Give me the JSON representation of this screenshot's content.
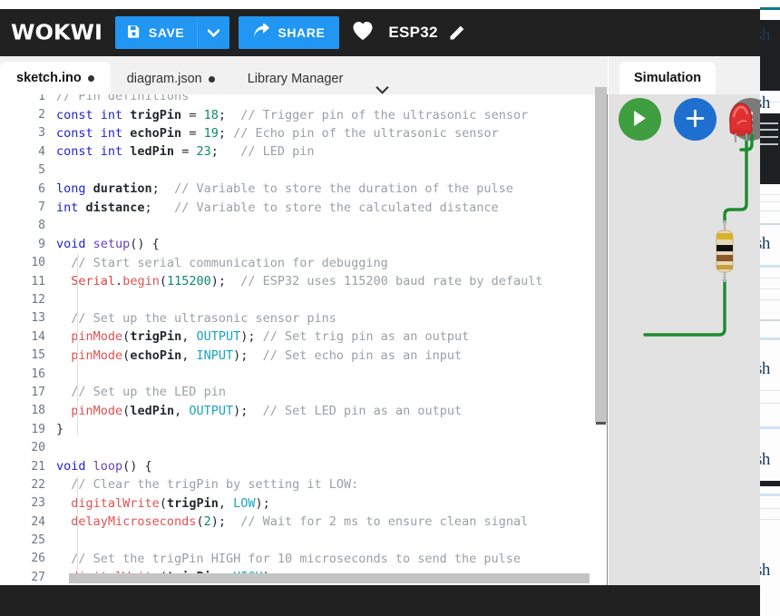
{
  "toolbar": {
    "logo": "WOKWI",
    "save_label": "SAVE",
    "save_icon": "floppy-disk-icon",
    "save_caret_icon": "chevron-down-icon",
    "share_label": "SHARE",
    "share_icon": "share-arrow-icon",
    "favorite_icon": "heart-icon",
    "project_name": "ESP32",
    "rename_icon": "pencil-icon"
  },
  "tabs": {
    "items": [
      {
        "label": "sketch.ino",
        "modified": true,
        "active": true
      },
      {
        "label": "diagram.json",
        "modified": true,
        "active": false
      },
      {
        "label": "Library Manager",
        "modified": false,
        "active": false
      }
    ],
    "overflow_icon": "chevron-down-icon"
  },
  "simulation": {
    "tab_label": "Simulation",
    "play_icon": "play-icon",
    "add_icon": "plus-icon",
    "menu_icon": "kebab-menu-icon",
    "components": [
      {
        "name": "led",
        "color": "#e03030",
        "label": "red LED"
      },
      {
        "name": "resistor",
        "label": "220 ohm resistor",
        "bands": [
          "#d8b22a",
          "#111111",
          "#8a5a28",
          "#c8a03a"
        ]
      },
      {
        "name": "wire-green",
        "color": "#1e8c2e"
      }
    ]
  },
  "editor": {
    "scroll_h_present": true,
    "scroll_v_present": true,
    "lines": [
      {
        "n": 1,
        "tokens": [
          {
            "t": "// Pin definitions",
            "c": "t-com"
          }
        ]
      },
      {
        "n": 2,
        "tokens": [
          {
            "t": "const int ",
            "c": "t-kw"
          },
          {
            "t": "trigPin",
            "c": "t-var"
          },
          {
            "t": " = ",
            "c": "t-plain"
          },
          {
            "t": "18",
            "c": "t-num"
          },
          {
            "t": ";  ",
            "c": "t-plain"
          },
          {
            "t": "// Trigger pin of the ultrasonic sensor",
            "c": "t-com"
          }
        ]
      },
      {
        "n": 3,
        "tokens": [
          {
            "t": "const int ",
            "c": "t-kw"
          },
          {
            "t": "echoPin",
            "c": "t-var"
          },
          {
            "t": " = ",
            "c": "t-plain"
          },
          {
            "t": "19",
            "c": "t-num"
          },
          {
            "t": "; ",
            "c": "t-plain"
          },
          {
            "t": "// Echo pin of the ultrasonic sensor",
            "c": "t-com"
          }
        ]
      },
      {
        "n": 4,
        "tokens": [
          {
            "t": "const int ",
            "c": "t-kw"
          },
          {
            "t": "ledPin",
            "c": "t-var"
          },
          {
            "t": " = ",
            "c": "t-plain"
          },
          {
            "t": "23",
            "c": "t-num"
          },
          {
            "t": ";   ",
            "c": "t-plain"
          },
          {
            "t": "// LED pin",
            "c": "t-com"
          }
        ]
      },
      {
        "n": 5,
        "tokens": []
      },
      {
        "n": 6,
        "tokens": [
          {
            "t": "long ",
            "c": "t-kw"
          },
          {
            "t": "duration",
            "c": "t-var"
          },
          {
            "t": ";  ",
            "c": "t-plain"
          },
          {
            "t": "// Variable to store the duration of the pulse",
            "c": "t-com"
          }
        ]
      },
      {
        "n": 7,
        "tokens": [
          {
            "t": "int ",
            "c": "t-kw"
          },
          {
            "t": "distance",
            "c": "t-var"
          },
          {
            "t": ";   ",
            "c": "t-plain"
          },
          {
            "t": "// Variable to store the calculated distance",
            "c": "t-com"
          }
        ]
      },
      {
        "n": 8,
        "tokens": []
      },
      {
        "n": 9,
        "tokens": [
          {
            "t": "void ",
            "c": "t-kw"
          },
          {
            "t": "setup",
            "c": "t-fn2"
          },
          {
            "t": "() {",
            "c": "t-plain"
          }
        ]
      },
      {
        "n": 10,
        "tokens": [
          {
            "t": "  ",
            "c": "t-plain"
          },
          {
            "t": "// Start serial communication for debugging",
            "c": "t-com"
          }
        ]
      },
      {
        "n": 11,
        "tokens": [
          {
            "t": "  ",
            "c": "t-plain"
          },
          {
            "t": "Serial",
            "c": "t-cls"
          },
          {
            "t": ".",
            "c": "t-plain"
          },
          {
            "t": "begin",
            "c": "t-fn"
          },
          {
            "t": "(",
            "c": "t-plain"
          },
          {
            "t": "115200",
            "c": "t-num"
          },
          {
            "t": ");  ",
            "c": "t-plain"
          },
          {
            "t": "// ESP32 uses 115200 baud rate by default",
            "c": "t-com"
          }
        ]
      },
      {
        "n": 12,
        "tokens": []
      },
      {
        "n": 13,
        "tokens": [
          {
            "t": "  ",
            "c": "t-plain"
          },
          {
            "t": "// Set up the ultrasonic sensor pins",
            "c": "t-com"
          }
        ]
      },
      {
        "n": 14,
        "tokens": [
          {
            "t": "  ",
            "c": "t-plain"
          },
          {
            "t": "pinMode",
            "c": "t-fn"
          },
          {
            "t": "(",
            "c": "t-plain"
          },
          {
            "t": "trigPin",
            "c": "t-var"
          },
          {
            "t": ", ",
            "c": "t-plain"
          },
          {
            "t": "OUTPUT",
            "c": "t-const"
          },
          {
            "t": "); ",
            "c": "t-plain"
          },
          {
            "t": "// Set trig pin as an output",
            "c": "t-com"
          }
        ]
      },
      {
        "n": 15,
        "tokens": [
          {
            "t": "  ",
            "c": "t-plain"
          },
          {
            "t": "pinMode",
            "c": "t-fn"
          },
          {
            "t": "(",
            "c": "t-plain"
          },
          {
            "t": "echoPin",
            "c": "t-var"
          },
          {
            "t": ", ",
            "c": "t-plain"
          },
          {
            "t": "INPUT",
            "c": "t-const"
          },
          {
            "t": ");  ",
            "c": "t-plain"
          },
          {
            "t": "// Set echo pin as an input",
            "c": "t-com"
          }
        ]
      },
      {
        "n": 16,
        "tokens": []
      },
      {
        "n": 17,
        "tokens": [
          {
            "t": "  ",
            "c": "t-plain"
          },
          {
            "t": "// Set up the LED pin",
            "c": "t-com"
          }
        ]
      },
      {
        "n": 18,
        "tokens": [
          {
            "t": "  ",
            "c": "t-plain"
          },
          {
            "t": "pinMode",
            "c": "t-fn"
          },
          {
            "t": "(",
            "c": "t-plain"
          },
          {
            "t": "ledPin",
            "c": "t-var"
          },
          {
            "t": ", ",
            "c": "t-plain"
          },
          {
            "t": "OUTPUT",
            "c": "t-const"
          },
          {
            "t": ");  ",
            "c": "t-plain"
          },
          {
            "t": "// Set LED pin as an output",
            "c": "t-com"
          }
        ]
      },
      {
        "n": 19,
        "tokens": [
          {
            "t": "}",
            "c": "t-plain"
          }
        ]
      },
      {
        "n": 20,
        "tokens": []
      },
      {
        "n": 21,
        "tokens": [
          {
            "t": "void ",
            "c": "t-kw"
          },
          {
            "t": "loop",
            "c": "t-fn2"
          },
          {
            "t": "() {",
            "c": "t-plain"
          }
        ]
      },
      {
        "n": 22,
        "tokens": [
          {
            "t": "  ",
            "c": "t-plain"
          },
          {
            "t": "// Clear the trigPin by setting it LOW:",
            "c": "t-com"
          }
        ]
      },
      {
        "n": 23,
        "tokens": [
          {
            "t": "  ",
            "c": "t-plain"
          },
          {
            "t": "digitalWrite",
            "c": "t-fn"
          },
          {
            "t": "(",
            "c": "t-plain"
          },
          {
            "t": "trigPin",
            "c": "t-var"
          },
          {
            "t": ", ",
            "c": "t-plain"
          },
          {
            "t": "LOW",
            "c": "t-const"
          },
          {
            "t": ");",
            "c": "t-plain"
          }
        ]
      },
      {
        "n": 24,
        "tokens": [
          {
            "t": "  ",
            "c": "t-plain"
          },
          {
            "t": "delayMicroseconds",
            "c": "t-fn"
          },
          {
            "t": "(",
            "c": "t-plain"
          },
          {
            "t": "2",
            "c": "t-num"
          },
          {
            "t": ");  ",
            "c": "t-plain"
          },
          {
            "t": "// Wait for 2 ms to ensure clean signal",
            "c": "t-com"
          }
        ]
      },
      {
        "n": 25,
        "tokens": []
      },
      {
        "n": 26,
        "tokens": [
          {
            "t": "  ",
            "c": "t-plain"
          },
          {
            "t": "// Set the trigPin HIGH for 10 microseconds to send the pulse",
            "c": "t-com"
          }
        ]
      },
      {
        "n": 27,
        "tokens": [
          {
            "t": "  ",
            "c": "t-plain"
          },
          {
            "t": "digitalWrite",
            "c": "t-fn"
          },
          {
            "t": "(",
            "c": "t-plain"
          },
          {
            "t": "trigPin",
            "c": "t-var"
          },
          {
            "t": ", ",
            "c": "t-plain"
          },
          {
            "t": "HIGH",
            "c": "t-const"
          },
          {
            "t": ");",
            "c": "t-plain"
          }
        ]
      }
    ]
  },
  "background_page": {
    "fragments": [
      "sh",
      "sh",
      "sh",
      "sh",
      "sh",
      "sh"
    ]
  },
  "colors": {
    "accent_blue": "#2196f3",
    "toolbar_dark": "#212121",
    "panel_gray": "#e2e2e2",
    "play_green": "#3f9e3f",
    "add_blue": "#1e6fd0",
    "menu_gray": "#7a7a7a",
    "led_red": "#e03030",
    "wire_green": "#1e8c2e"
  }
}
